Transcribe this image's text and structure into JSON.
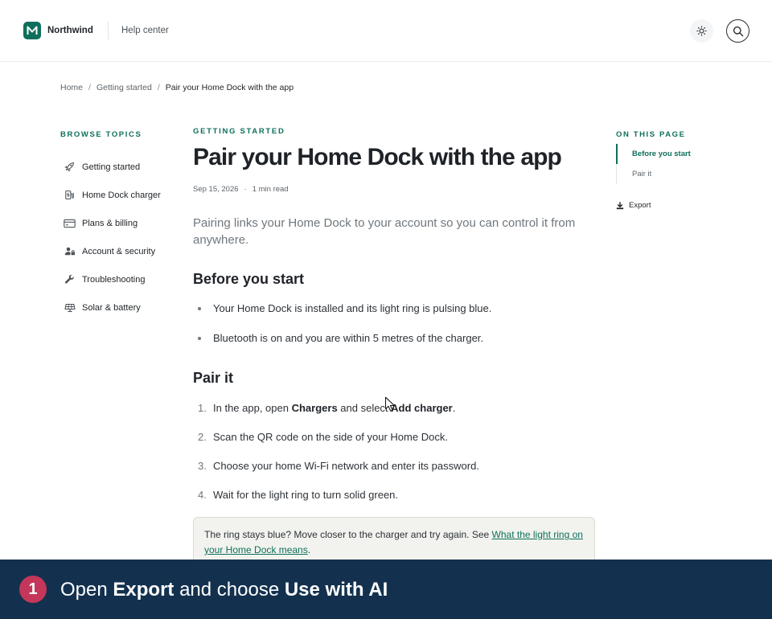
{
  "header": {
    "brand_name": "Northwind",
    "brand_logo_letter": "M",
    "help_center_label": "Help center",
    "theme_toggle_icon": "sun-icon",
    "search_icon": "search-icon"
  },
  "breadcrumb": {
    "items": [
      "Home",
      "Getting started",
      "Pair your Home Dock with the app"
    ],
    "separator": "/"
  },
  "sidebar": {
    "title": "BROWSE TOPICS",
    "items": [
      {
        "label": "Getting started",
        "icon": "rocket-icon"
      },
      {
        "label": "Home Dock charger",
        "icon": "charger-icon"
      },
      {
        "label": "Plans & billing",
        "icon": "credit-card-icon"
      },
      {
        "label": "Account & security",
        "icon": "user-lock-icon"
      },
      {
        "label": "Troubleshooting",
        "icon": "wrench-icon"
      },
      {
        "label": "Solar & battery",
        "icon": "solar-panel-icon"
      }
    ]
  },
  "article": {
    "eyebrow": "GETTING STARTED",
    "title": "Pair your Home Dock with the app",
    "date": "Sep 15, 2026",
    "meta_separator": "·",
    "read_time": "1 min read",
    "lead": "Pairing links your Home Dock to your account so you can control it from anywhere.",
    "section1_title": "Before you start",
    "section1_items": [
      "Your Home Dock is installed and its light ring is pulsing blue.",
      "Bluetooth is on and you are within 5 metres of the charger."
    ],
    "section2_title": "Pair it",
    "steps": {
      "step1": {
        "num": "1.",
        "prefix": "In the app, open ",
        "bold1": "Chargers",
        "middle": " and select ",
        "bold2": "Add charger",
        "suffix": "."
      },
      "step2": {
        "num": "2.",
        "text": "Scan the QR code on the side of your Home Dock."
      },
      "step3": {
        "num": "3.",
        "text": "Choose your home Wi-Fi network and enter its password."
      },
      "step4": {
        "num": "4.",
        "text": "Wait for the light ring to turn solid green."
      }
    },
    "note": {
      "text": "The ring stays blue? Move closer to the charger and try again. See ",
      "link": "What the light ring on your Home Dock means",
      "suffix": "."
    }
  },
  "toc": {
    "title": "ON THIS PAGE",
    "items": [
      {
        "label": "Before you start",
        "active": true
      },
      {
        "label": "Pair it",
        "active": false
      }
    ],
    "export_label": "Export",
    "export_icon": "download-icon"
  },
  "caption": {
    "step_number": "1",
    "part1": "Open ",
    "bold1": "Export",
    "part2": " and choose ",
    "bold2": "Use with AI"
  },
  "colors": {
    "accent": "#0f6f5c",
    "caption_bg": "#13314f",
    "badge": "#c4375a",
    "note_bg": "#f2f3ee"
  }
}
